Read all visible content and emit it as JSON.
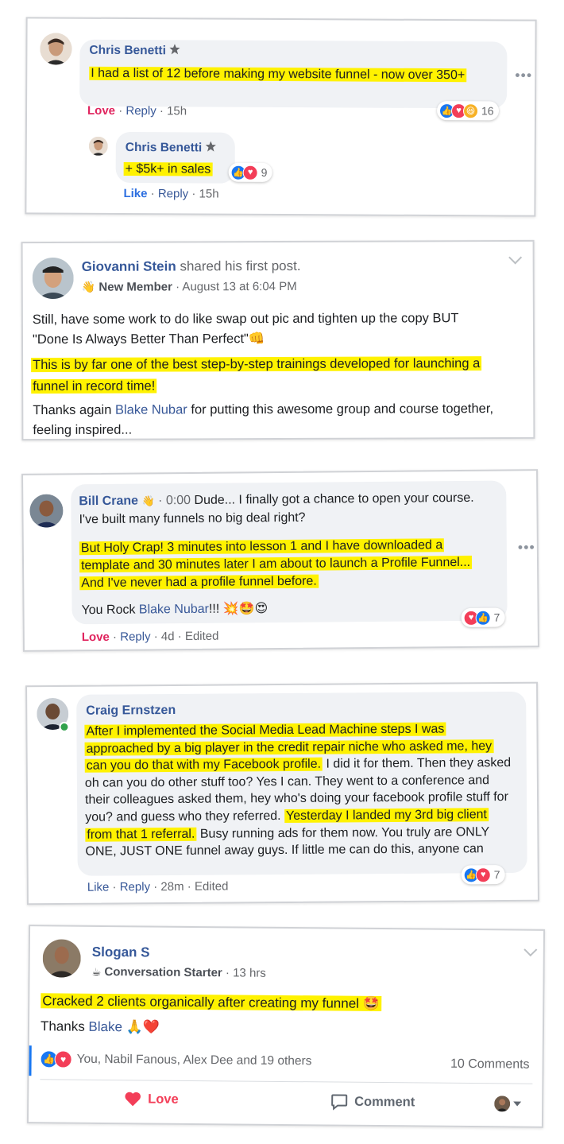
{
  "card1": {
    "comment": {
      "author": "Chris Benetti",
      "text": "I had a list of 12 before making my website funnel - now over 350+",
      "reaction_label": "Love",
      "reply_label": "Reply",
      "time": "15h",
      "reaction_count": "16"
    },
    "reply": {
      "author": "Chris Benetti",
      "text": "+ $5k+ in sales",
      "reaction_count": "9",
      "like_label": "Like",
      "reply_label": "Reply",
      "time": "15h"
    },
    "more_label": "•••"
  },
  "card2": {
    "author": "Giovanni Stein",
    "action": "shared his first post.",
    "badge": "New Member",
    "date": "August 13 at 6:04 PM",
    "text_line1": "Still, have some work to do like swap out pic and tighten up the copy BUT",
    "text_line2": "\"Done Is Always Better Than Perfect\"",
    "highlight": "This is by far one of the best step-by-step trainings developed for launching a funnel in record time!",
    "thanks_before": "Thanks again ",
    "mention": "Blake Nubar",
    "thanks_after": " for putting this awesome group and course together, feeling inspired..."
  },
  "card3": {
    "author": "Bill Crane",
    "timestamp": "0:00",
    "text_intro": "Dude... I finally got a chance to open your course. I've built many funnels no big deal right?",
    "highlight": "But Holy Crap! 3 minutes into lesson 1 and I have downloaded a template and 30 minutes later I am about to launch a Profile Funnel... And I've never had a profile funnel before.",
    "outro_before": "You Rock ",
    "mention": "Blake Nubar",
    "outro_after": "!!!",
    "reaction_count": "7",
    "reaction_label": "Love",
    "reply_label": "Reply",
    "time": "4d",
    "edited": "Edited",
    "more_label": "•••"
  },
  "card4": {
    "author": "Craig Ernstzen",
    "highlight1": "After I implemented the Social Media Lead Machine steps I was approached by a big player in the credit repair niche who asked me, hey can you do that with my Facebook profile.",
    "text1": " I did it for them. Then they asked oh can you do other stuff too? Yes I can. They went to a conference and their colleagues asked them, hey who's doing your facebook profile stuff for you? and guess who they referred. ",
    "highlight2": "Yesterday I landed my 3rd big client from that 1 referral.",
    "text2": " Busy running ads for them now. You truly are ONLY ONE, JUST ONE funnel away guys. If little me can do this, anyone can",
    "reaction_count": "7",
    "like_label": "Like",
    "reply_label": "Reply",
    "time": "28m",
    "edited": "Edited"
  },
  "card5": {
    "author": "Slogan S",
    "badge": "Conversation Starter",
    "time": "13 hrs",
    "highlight": "Cracked 2 clients organically after creating my funnel",
    "thanks": "Thanks ",
    "mention": "Blake",
    "reactors": "You, Nabil Fanous, Alex Dee and 19 others",
    "comments": "10 Comments",
    "love_label": "Love",
    "comment_label": "Comment"
  },
  "colors": {
    "highlight": "#fff200",
    "name": "#365899",
    "love": "#e0245e",
    "like": "#1877f2",
    "bubble": "#f0f2f5"
  }
}
